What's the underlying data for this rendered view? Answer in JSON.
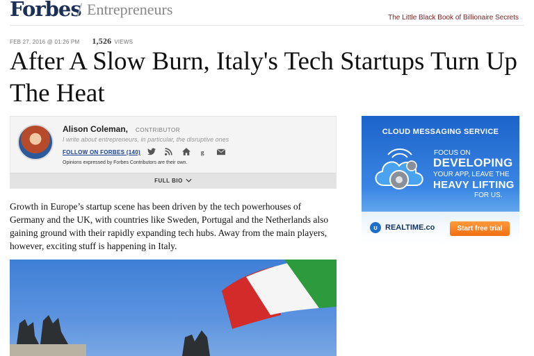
{
  "header": {
    "logo": "Forbes",
    "separator": "/",
    "section": "Entrepreneurs",
    "promo_link": "The Little Black Book of Billionaire Secrets"
  },
  "meta": {
    "datetime": "FEB 27, 2016 @ 01:26 PM",
    "views": "1,526",
    "views_label": "VIEWS"
  },
  "article": {
    "title": "After A Slow Burn, Italy's Tech Startups Turn Up The Heat",
    "body": "Growth in Europe’s startup scene has been driven by the tech powerhouses of Germany and the UK, with countries like Sweden, Portugal and the Netherlands also gaining ground with their rapidly expanding tech hubs. Away from the main players, however, exciting stuff is happening in Italy."
  },
  "author": {
    "name": "Alison Coleman,",
    "role": "CONTRIBUTOR",
    "bio": "I write about entrepreneurs, in particular, the disruptive ones",
    "follow_label": "FOLLOW ON FORBES (140)",
    "social_icons": [
      "twitter-icon",
      "rss-icon",
      "home-icon",
      "google-plus-icon",
      "email-icon"
    ],
    "disclaimer": "Opinions expressed by Forbes Contributors are their own.",
    "full_bio_label": "FULL BIO"
  },
  "ad": {
    "title": "CLOUD MESSAGING SERVICE",
    "line1": "FOCUS ON",
    "line2": "DEVELOPING",
    "line3": "YOUR APP, LEAVE THE",
    "line4": "HEAVY LIFTING",
    "line5": "FOR US.",
    "brand": "REALTIME.co",
    "cta": "Start free trial"
  },
  "colors": {
    "logo": "#1c2f57",
    "promo": "#7a1e1e",
    "follow_link": "#1c3f8f",
    "ad_cta": "#f26f12"
  }
}
